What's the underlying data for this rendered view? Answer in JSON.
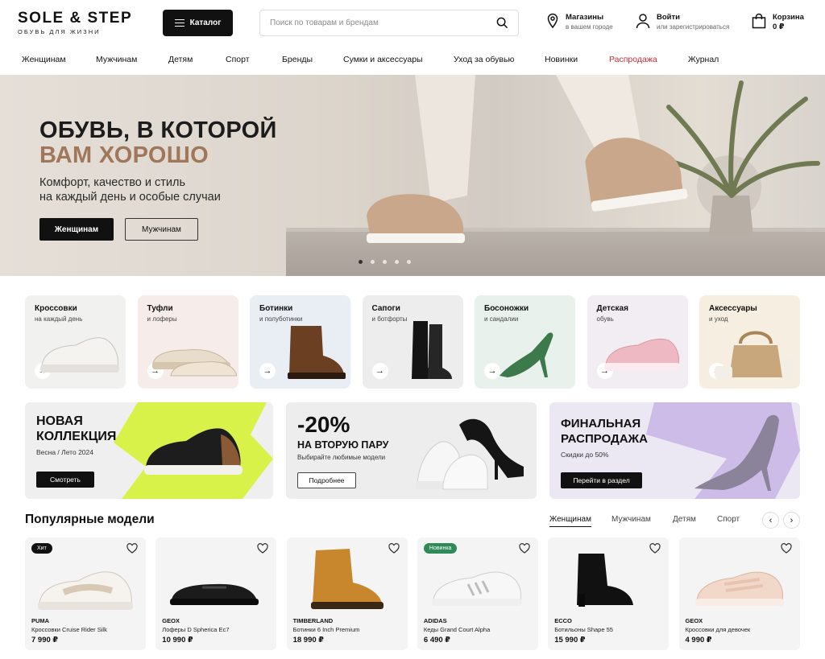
{
  "header": {
    "logo_main": "SOLE & STEP",
    "logo_sub": "ОБУВЬ ДЛЯ ЖИЗНИ",
    "catalog_label": "Каталог",
    "search_placeholder": "Поиск по товарам и брендам",
    "stores": {
      "title": "Магазины",
      "subtitle": "в вашем городе"
    },
    "login": {
      "title": "Войти",
      "subtitle": "или зарегистрироваться"
    },
    "cart": {
      "title": "Корзина",
      "subtitle": "0 ₽"
    }
  },
  "nav": [
    "Женщинам",
    "Мужчинам",
    "Детям",
    "Спорт",
    "Бренды",
    "Сумки и аксессуары",
    "Уход за обувью",
    "Новинки",
    "Распродажа",
    "Журнал"
  ],
  "hero": {
    "title_line1": "ОБУВЬ, В КОТОРОЙ",
    "title_line2": "ВАМ ХОРОШО",
    "text_line1": "Комфорт, качество и стиль",
    "text_line2": "на каждый день и особые случаи",
    "btn_women": "Женщинам",
    "btn_men": "Мужчинам",
    "slides_total": 5,
    "slide_active": 1
  },
  "categories": [
    {
      "title": "Кроссовки",
      "subtitle": "на каждый день",
      "bg": "#f1f1f0",
      "icon": "sneaker"
    },
    {
      "title": "Туфли",
      "subtitle": "и лоферы",
      "bg": "#f6ecea",
      "icon": "loafer"
    },
    {
      "title": "Ботинки",
      "subtitle": "и полуботинки",
      "bg": "#e9eef4",
      "icon": "boot"
    },
    {
      "title": "Сапоги",
      "subtitle": "и ботфорты",
      "bg": "#ededed",
      "icon": "tall-boot"
    },
    {
      "title": "Босоножки",
      "subtitle": "и сандалии",
      "bg": "#e9f1ec",
      "icon": "sandal"
    },
    {
      "title": "Детская",
      "subtitle": "обувь",
      "bg": "#f2ecf3",
      "icon": "kids-sneaker"
    },
    {
      "title": "Аксессуары",
      "subtitle": "и уход",
      "bg": "#f6efe1",
      "icon": "bag"
    }
  ],
  "promos": [
    {
      "title_line1": "НОВАЯ",
      "title_line2": "КОЛЛЕКЦИЯ",
      "subtitle": "Весна / Лето 2024",
      "button": "Смотреть",
      "accent": "#d9f24a"
    },
    {
      "title_line1": "-20%",
      "title_line2": "НА ВТОРУЮ ПАРУ",
      "subtitle": "Выбирайте любимые модели",
      "button": "Подробнее"
    },
    {
      "title_line1": "ФИНАЛЬНАЯ",
      "title_line2": "РАСПРОДАЖА",
      "subtitle": "Скидки до 50%",
      "button": "Перейти в раздел",
      "accent": "#c9b6e6"
    }
  ],
  "popular": {
    "title": "Популярные модели",
    "tabs": [
      "Женщинам",
      "Мужчинам",
      "Детям",
      "Спорт"
    ],
    "active_tab": "Женщинам",
    "products": [
      {
        "badge": "Хит",
        "badge_color": "#111111",
        "brand": "PUMA",
        "name": "Кроссовки Cruise Rider Silk",
        "price": "7 990 ₽"
      },
      {
        "badge": "",
        "brand": "GEOX",
        "name": "Лоферы D Spherica Ec7",
        "price": "10 990 ₽"
      },
      {
        "badge": "",
        "brand": "TIMBERLAND",
        "name": "Ботинки 6 Inch Premium",
        "price": "18 990 ₽"
      },
      {
        "badge": "Новинка",
        "badge_color": "#2e8b57",
        "brand": "ADIDAS",
        "name": "Кеды Grand Court Alpha",
        "price": "6 490 ₽"
      },
      {
        "badge": "",
        "brand": "ECCO",
        "name": "Ботильоны Shape 55",
        "price": "15 990 ₽"
      },
      {
        "badge": "",
        "brand": "GEOX",
        "name": "Кроссовки для девочек",
        "price": "4 990 ₽"
      }
    ]
  }
}
